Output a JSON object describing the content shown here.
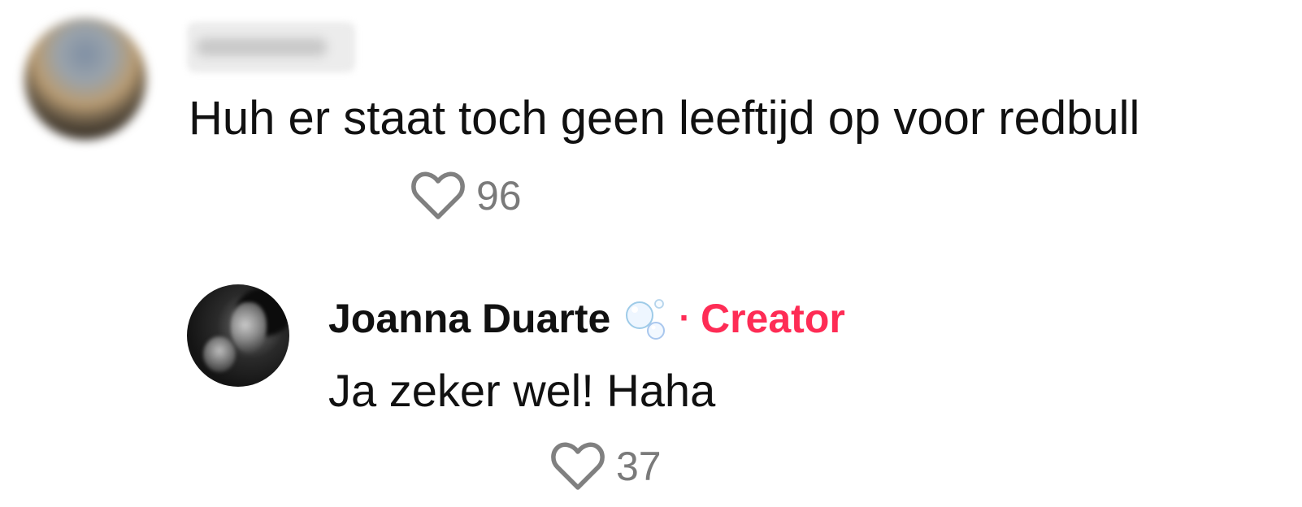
{
  "comment": {
    "text": "Huh er staat toch geen leeftijd op voor redbull",
    "likes": "96",
    "like_icon": "heart-outline-icon"
  },
  "reply": {
    "author": "Joanna Duarte",
    "author_emoji_icon": "bubbles-icon",
    "separator": "·",
    "badge": "Creator",
    "text": "Ja zeker wel! Haha",
    "likes": "37",
    "like_icon": "heart-outline-icon"
  },
  "colors": {
    "text": "#111111",
    "muted": "#7a7a7a",
    "creator_accent": "#fe2c55",
    "background": "#ffffff"
  }
}
